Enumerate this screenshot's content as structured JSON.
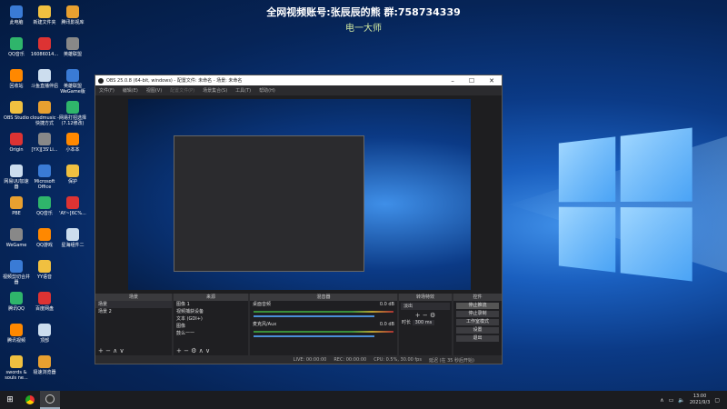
{
  "banner": {
    "line1": "全网视频账号:张辰辰的熊  群:758734339",
    "line2": "电一大师"
  },
  "desktop_icons": [
    "此电脑",
    "新建文件夹",
    "腾讯影视库",
    "QQ音乐",
    "16086014...",
    "英雄联盟",
    "回收站",
    "斗鱼直播伴侣",
    "英雄联盟 WeGame版",
    "OBS Studio",
    "cloudmusic - 快捷方式",
    "网易打招选择 (7.12修改)",
    "Origin",
    "[YX][3S'Li...",
    "小本本",
    "网易UU加速器",
    "Microsoft Office",
    "保护",
    "PBE",
    "QQ音乐",
    "'AY~[6C%...",
    "WeGame",
    "QQ游戏",
    "星海组件二",
    "视频剪切合并器",
    "YY语音",
    "",
    "腾讯QQ",
    "百度网盘",
    "",
    "腾讯视频",
    "顶部",
    "",
    "swords & souls ne...",
    "极速浏览器",
    ""
  ],
  "obs": {
    "title": "OBS 25.0.8 (64-bit, windows) - 配置文件: 未命名 - 场景: 未命名",
    "menu": [
      "文件(F)",
      "编辑(E)",
      "视图(V)",
      "配置文件(P)",
      "场景集合(S)",
      "工具(T)",
      "帮助(H)"
    ],
    "docks": {
      "scenes": {
        "title": "场景",
        "items": [
          "场景",
          "场景 2"
        ]
      },
      "sources": {
        "title": "来源",
        "items": [
          "图像 1",
          "视频捕获设备",
          "文本 (GDI+)",
          "图像",
          "鼓么一一",
          "鼓么一一"
        ]
      },
      "mixer": {
        "title": "混音器",
        "channels": [
          {
            "name": "桌面音频",
            "level": "0.0 dB"
          },
          {
            "name": "麦克风/Aux",
            "level": "0.0 dB"
          }
        ]
      },
      "transitions": {
        "title": "转场特效",
        "type": "淡出",
        "duration_label": "时长",
        "duration": "300 ms"
      },
      "controls": {
        "title": "控件",
        "buttons": [
          "停止推流",
          "停止录制",
          "工作室模式",
          "设置",
          "退出"
        ]
      }
    },
    "status": {
      "live": "LIVE: 00:00:00",
      "rec": "REC: 00:00:00",
      "cpu": "CPU: 0.5%, 30.00 fps",
      "delay": "延迟 (在 35 秒后开始)"
    }
  },
  "taskbar": {
    "time": "13:00",
    "date": "2021/9/3"
  }
}
